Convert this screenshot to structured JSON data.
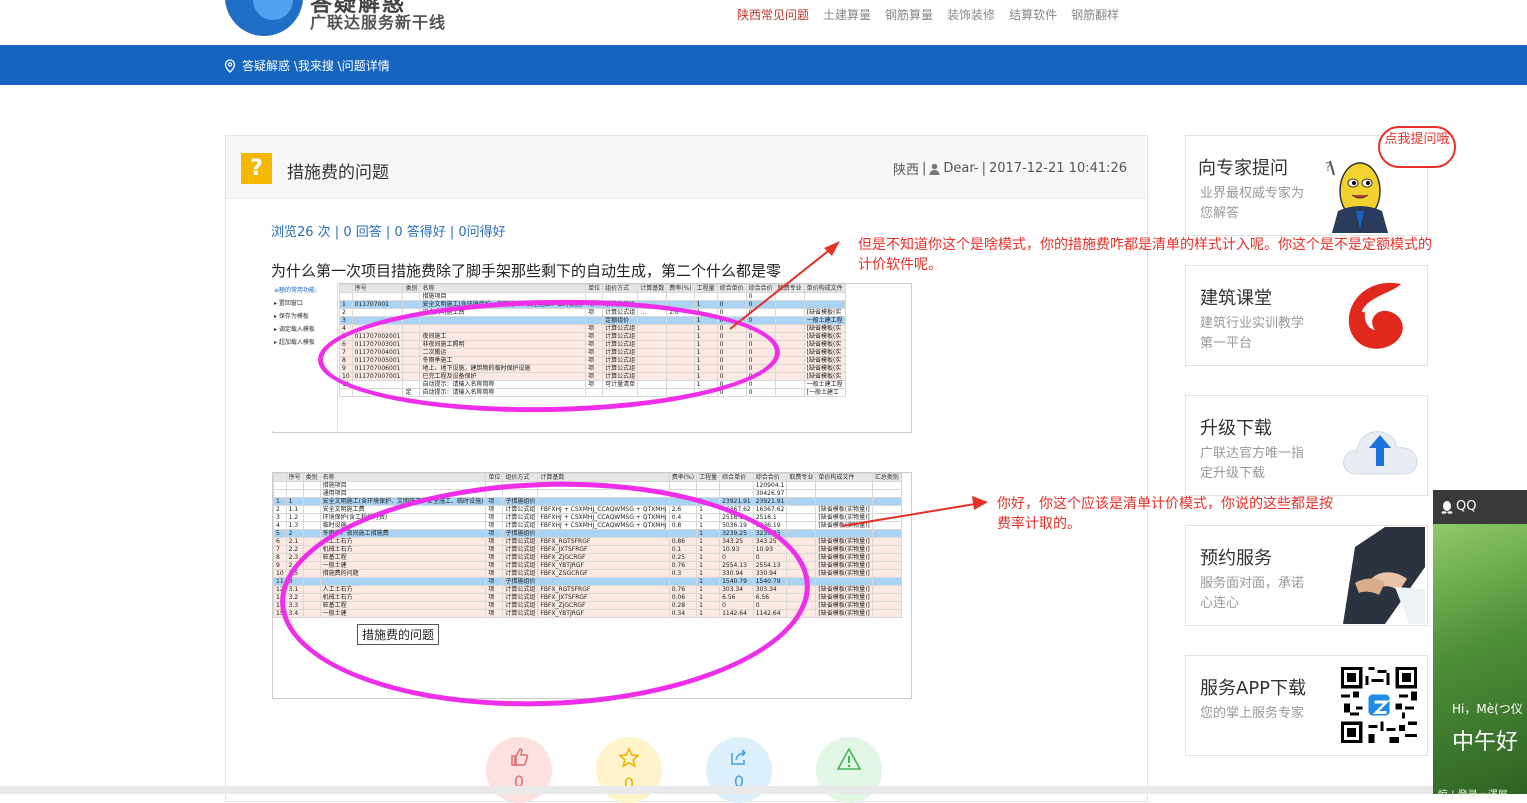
{
  "header": {
    "logo_title": "答疑解惑",
    "logo_subtitle": "广联达服务新干线",
    "nav": [
      {
        "label": "陕西常见问题",
        "active": true
      },
      {
        "label": "土建算量",
        "active": false
      },
      {
        "label": "钢筋算量",
        "active": false
      },
      {
        "label": "装饰装修",
        "active": false
      },
      {
        "label": "结算软件",
        "active": false
      },
      {
        "label": "钢筋翻样",
        "active": false
      }
    ],
    "breadcrumb": "答疑解惑 \\我来搜 \\问题详情",
    "bar_color": "#1565c0"
  },
  "question": {
    "icon": "question-mark-icon",
    "title": "措施费的问题",
    "region": "陕西",
    "sep1": "|",
    "author": "Dear-",
    "sep2": "|",
    "datetime": "2017-12-21 10:41:26",
    "stats": "浏览26 次 | 0 回答 | 0 答得好 | 0问得好",
    "body": "为什么第一次项目措施费除了脚手架那些剩下的自动生成，第二个什么都是零",
    "image_caption": "措施费的问题"
  },
  "sheet1": {
    "side_items": [
      "≡额的常用功能:",
      "▸ 置回窗口",
      "▸ 保存为模板",
      "▸ 调定载入模板",
      "▸ 超加载入模板"
    ],
    "headers": [
      "",
      "序号",
      "类别",
      "名称",
      "单位",
      "组价方式",
      "计算基数",
      "费率(%)",
      "工程量",
      "综合单价",
      "综合合价",
      "取费专业",
      "单价构成文件"
    ],
    "rows": [
      {
        "cls": "",
        "cells": [
          "",
          "",
          "",
          "措施项目",
          "",
          "",
          "",
          "",
          "",
          "",
          "0",
          "",
          ""
        ]
      },
      {
        "cls": "sel",
        "cells": [
          "1",
          "011707001",
          "",
          "安全文明施工(含环境保护、文明施工、安全施工、临时设施)",
          "项",
          "子措施组价",
          "",
          "",
          "1",
          "0",
          "0",
          "",
          ""
        ]
      },
      {
        "cls": "",
        "cells": [
          "2",
          "",
          "",
          "安全文明施工费",
          "项",
          "计算公式组",
          "…",
          "2.6",
          "1",
          "0",
          "0",
          "",
          "[缺省模板(实"
        ]
      },
      {
        "cls": "sel",
        "cells": [
          "3",
          "",
          "",
          "",
          "",
          "定额组价",
          "",
          "",
          "1",
          "0",
          "0",
          "",
          "一般土建工程"
        ]
      },
      {
        "cls": "band",
        "cells": [
          "4",
          "",
          "",
          "",
          "项",
          "计算公式组",
          "",
          "",
          "1",
          "0",
          "0",
          "",
          "[缺省模板(实"
        ]
      },
      {
        "cls": "band",
        "cells": [
          "5",
          "011707002001",
          "",
          "夜间施工",
          "项",
          "计算公式组",
          "",
          "",
          "1",
          "0",
          "0",
          "",
          "[缺省模板(实"
        ]
      },
      {
        "cls": "band",
        "cells": [
          "6",
          "011707003001",
          "",
          "非夜间施工照明",
          "项",
          "计算公式组",
          "",
          "",
          "1",
          "0",
          "0",
          "",
          "[缺省模板(实"
        ]
      },
      {
        "cls": "band",
        "cells": [
          "7",
          "011707004001",
          "",
          "二次搬运",
          "项",
          "计算公式组",
          "",
          "",
          "1",
          "0",
          "0",
          "",
          "[缺省模板(实"
        ]
      },
      {
        "cls": "band",
        "cells": [
          "8",
          "011707005001",
          "",
          "冬雨季施工",
          "项",
          "计算公式组",
          "",
          "",
          "1",
          "0",
          "0",
          "",
          "[缺省模板(实"
        ]
      },
      {
        "cls": "band",
        "cells": [
          "9",
          "011707006001",
          "",
          "地上、地下设施，建筑物的临时保护设施",
          "项",
          "计算公式组",
          "",
          "",
          "1",
          "0",
          "0",
          "",
          "[缺省模板(实"
        ]
      },
      {
        "cls": "band",
        "cells": [
          "10",
          "011707007001",
          "",
          "已完工程及设备保护",
          "项",
          "计算公式组",
          "",
          "",
          "1",
          "0",
          "0",
          "",
          "[缺省模板(实"
        ]
      },
      {
        "cls": "",
        "cells": [
          "11",
          "",
          "",
          "自动提示：请输入名称简称",
          "项",
          "可计量清单",
          "",
          "",
          "1",
          "0",
          "0",
          "",
          "一般土建工程"
        ]
      },
      {
        "cls": "",
        "cells": [
          "",
          "",
          "定",
          "自动提示：请输入名称简称",
          "",
          "",
          "",
          "",
          "",
          "0",
          "0",
          "",
          "[一般土建工"
        ]
      }
    ]
  },
  "sheet2": {
    "headers": [
      "",
      "序号",
      "类别",
      "名称",
      "单位",
      "组价方式",
      "计算基数",
      "费率(%)",
      "工程量",
      "综合单价",
      "综合合价",
      "取费专业",
      "单价构成文件",
      "汇总类别"
    ],
    "rows": [
      {
        "cls": "",
        "cells": [
          "",
          "",
          "",
          "措施项目",
          "",
          "",
          "",
          "",
          "",
          "",
          "120904.1",
          "",
          "",
          ""
        ]
      },
      {
        "cls": "",
        "cells": [
          "",
          "",
          "",
          "通用项目",
          "",
          "",
          "",
          "",
          "",
          "",
          "30426.97",
          "",
          "",
          ""
        ]
      },
      {
        "cls": "sel",
        "cells": [
          "1",
          "1",
          "",
          "安全文明施工(含环境保护、文明施工、安全施工、临时设施)",
          "项",
          "子措施组价",
          "",
          "",
          "1",
          "23921.91",
          "23921.91",
          "",
          "",
          ""
        ]
      },
      {
        "cls": "",
        "cells": [
          "2",
          "1.1",
          "",
          "安全文明施工费",
          "项",
          "计算公式组",
          "FBFXHJ + CSXMHJ_CCAQWMSG + QTXMHJ",
          "2.6",
          "1",
          "16367.62",
          "16367.62",
          "",
          "[缺省模板(实物量)]",
          ""
        ]
      },
      {
        "cls": "",
        "cells": [
          "3",
          "1.2",
          "",
          "环境保护(含工程排污费)",
          "项",
          "计算公式组",
          "FBFXHJ + CSXMHJ_CCAQWMSG + QTXMHJ",
          "0.4",
          "1",
          "2518.1",
          "2518.1",
          "",
          "[缺省模板(实物量)]",
          ""
        ]
      },
      {
        "cls": "",
        "cells": [
          "4",
          "1.3",
          "",
          "临时设施",
          "项",
          "计算公式组",
          "FBFXHJ + CSXMHJ_CCAQWMSG + QTXMHJ",
          "0.8",
          "1",
          "5036.19",
          "5036.19",
          "",
          "[缺省模板(实物量)]",
          ""
        ]
      },
      {
        "cls": "sel",
        "cells": [
          "5",
          "2",
          "",
          "冬雨季、夜间施工措施费",
          "项",
          "子措施组价",
          "",
          "",
          "1",
          "3239.25",
          "3239.25",
          "",
          "",
          ""
        ]
      },
      {
        "cls": "band",
        "cells": [
          "6",
          "2.1",
          "",
          "人工土石方",
          "项",
          "计算公式组",
          "FBFX_RGTSFRGF",
          "0.86",
          "1",
          "343.25",
          "343.25",
          "",
          "[缺省模板(实物量)]",
          ""
        ]
      },
      {
        "cls": "band",
        "cells": [
          "7",
          "2.2",
          "",
          "机械土石方",
          "项",
          "计算公式组",
          "FBFX_JXTSFRGF",
          "0.1",
          "1",
          "10.93",
          "10.93",
          "",
          "[缺省模板(实物量)]",
          ""
        ]
      },
      {
        "cls": "band",
        "cells": [
          "8",
          "2.3",
          "",
          "桩基工程",
          "项",
          "计算公式组",
          "FBFX_ZJGCRGF",
          "0.25",
          "1",
          "0",
          "0",
          "",
          "[缺省模板(实物量)]",
          ""
        ]
      },
      {
        "cls": "band",
        "cells": [
          "9",
          "2.4",
          "",
          "一般土建",
          "项",
          "计算公式组",
          "FBFX_YBTJRGF",
          "0.76",
          "1",
          "2554.13",
          "2554.13",
          "",
          "[缺省模板(实物量)]",
          ""
        ]
      },
      {
        "cls": "band",
        "cells": [
          "10",
          "2.5",
          "",
          "措施费的问题",
          "项",
          "计算公式组",
          "FBFX_ZSGCRGF",
          "0.3",
          "1",
          "330.94",
          "330.94",
          "",
          "[缺省模板(实物量)]",
          ""
        ]
      },
      {
        "cls": "sel",
        "cells": [
          "11",
          "3",
          "",
          "",
          "项",
          "子措施组价",
          "",
          "",
          "1",
          "1540.79",
          "1540.79",
          "",
          "",
          ""
        ]
      },
      {
        "cls": "band",
        "cells": [
          "12",
          "3.1",
          "",
          "人工土石方",
          "项",
          "计算公式组",
          "FBFX_RGTSFRGF",
          "0.76",
          "1",
          "303.34",
          "303.34",
          "",
          "[缺省模板(实物量)]",
          ""
        ]
      },
      {
        "cls": "band",
        "cells": [
          "13",
          "3.2",
          "",
          "机械土石方",
          "项",
          "计算公式组",
          "FBFX_JXTSFRGF",
          "0.06",
          "1",
          "6.56",
          "6.56",
          "",
          "[缺省模板(实物量)]",
          ""
        ]
      },
      {
        "cls": "band",
        "cells": [
          "14",
          "3.3",
          "",
          "桩基工程",
          "项",
          "计算公式组",
          "FBFX_ZJGCRGF",
          "0.28",
          "1",
          "0",
          "0",
          "",
          "[缺省模板(实物量)]",
          ""
        ]
      },
      {
        "cls": "band",
        "cells": [
          "15",
          "3.4",
          "",
          "一般土建",
          "项",
          "计算公式组",
          "FBFX_YBTJRGF",
          "0.34",
          "1",
          "1142.64",
          "1142.64",
          "",
          "[缺省模板(实物量)]",
          ""
        ]
      }
    ]
  },
  "annotations": {
    "note1": "但是不知道你这个是啥模式，你的措施费咋都是清单的样式计入呢。你这个是不是定额模式的计价软件呢。",
    "note2": "你好，你这个应该是清单计价模式，你说的这些都是按费率计取的。",
    "color": "#e4312a",
    "ring_color": "#ee2ee8"
  },
  "actions": [
    {
      "icon": "thumbs-up-icon",
      "count": "0"
    },
    {
      "icon": "star-icon",
      "count": "0"
    },
    {
      "icon": "share-icon",
      "count": "0"
    },
    {
      "icon": "warning-icon",
      "count": ""
    }
  ],
  "sidebar": [
    {
      "title": "向专家提问",
      "desc": "业界最权威专家为您解答",
      "bubble": "点我提问哦",
      "icon": "mascot-icon"
    },
    {
      "title": "建筑课堂",
      "desc": "建筑行业实训教学第一平台",
      "icon": "swirl-logo-icon"
    },
    {
      "title": "升级下载",
      "desc": "广联达官方唯一指定升级下载",
      "icon": "cloud-download-icon"
    },
    {
      "title": "预约服务",
      "desc": "服务面对面，承诺心连心",
      "icon": "handshake-icon"
    },
    {
      "title": "服务APP下载",
      "desc": "您的掌上服务专家",
      "icon": "qr-code-icon"
    }
  ],
  "qq_widget": {
    "label": "QQ",
    "hi": "Hi，Mè(つ仪",
    "greeting": "中午好",
    "footer": "惊 | 登录一逻屏"
  }
}
